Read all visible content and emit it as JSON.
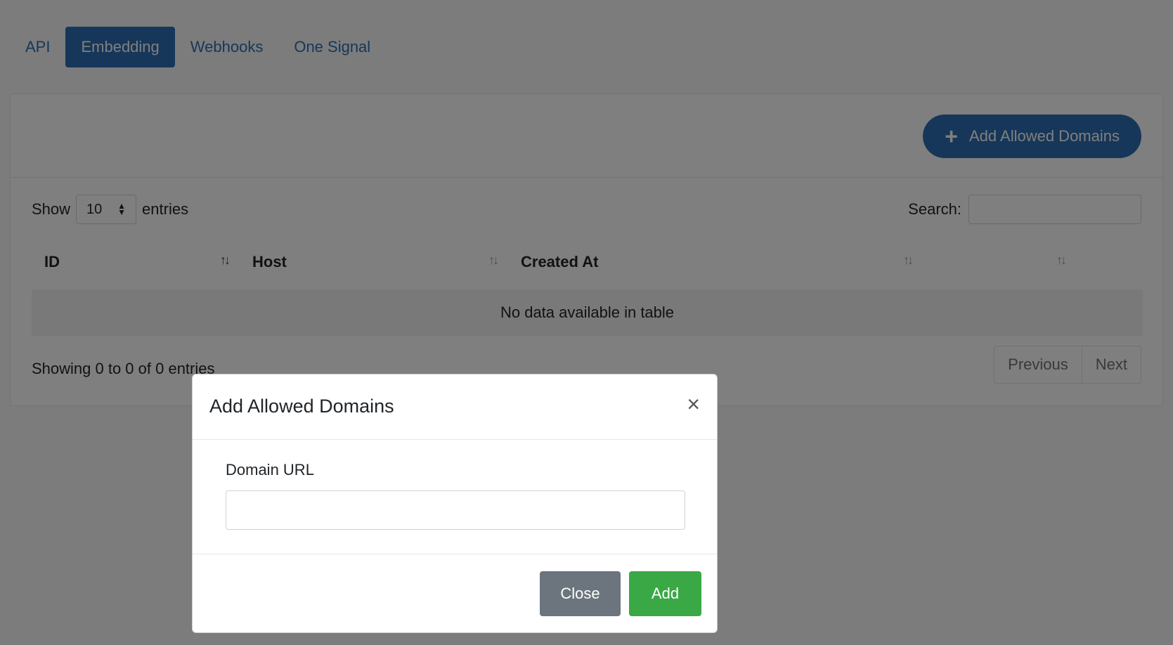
{
  "tabs": [
    {
      "label": "API",
      "active": false
    },
    {
      "label": "Embedding",
      "active": true
    },
    {
      "label": "Webhooks",
      "active": false
    },
    {
      "label": "One Signal",
      "active": false
    }
  ],
  "card": {
    "add_button_label": "Add Allowed Domains",
    "add_button_icon": "plus-icon"
  },
  "table_controls": {
    "show_label": "Show",
    "entries_value": "10",
    "entries_label": "entries",
    "search_label": "Search:",
    "search_value": ""
  },
  "table": {
    "columns": [
      "ID",
      "Host",
      "Created At",
      ""
    ],
    "empty_message": "No data available in table",
    "info": "Showing 0 to 0 of 0 entries",
    "pagination": {
      "previous": "Previous",
      "next": "Next"
    }
  },
  "modal": {
    "title": "Add Allowed Domains",
    "close_icon": "×",
    "field_label": "Domain URL",
    "field_value": "",
    "close_button": "Close",
    "add_button": "Add"
  },
  "colors": {
    "primary": "#2d6fb3",
    "success": "#3aa845",
    "secondary": "#6c757d"
  }
}
